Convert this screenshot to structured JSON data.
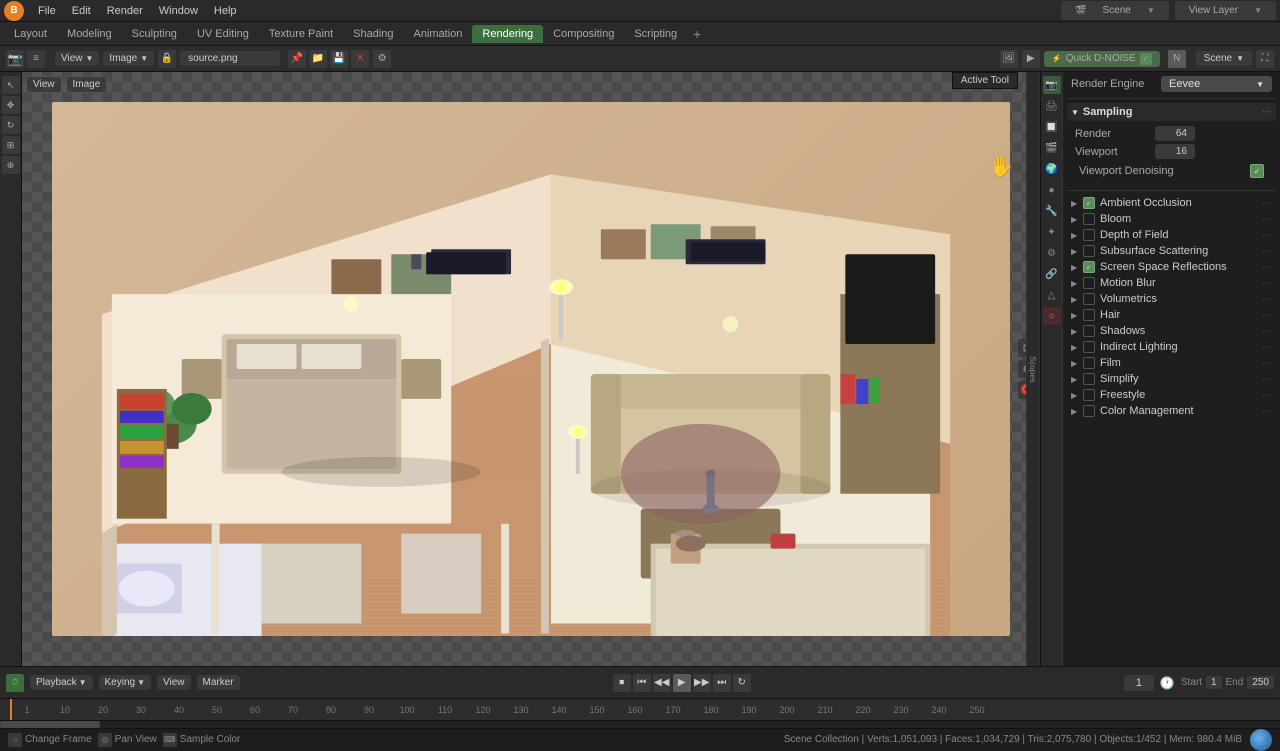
{
  "app": {
    "title": "Blender",
    "icon": "B"
  },
  "menubar": {
    "items": [
      "File",
      "Edit",
      "Render",
      "Window",
      "Help"
    ],
    "active": "Layout",
    "scene_name": "Scene",
    "layer_name": "View Layer"
  },
  "workspace_tabs": {
    "tabs": [
      "Layout",
      "Modeling",
      "Sculpting",
      "UV Editing",
      "Texture Paint",
      "Shading",
      "Animation",
      "Rendering",
      "Compositing",
      "Scripting"
    ],
    "active": "Rendering"
  },
  "image_editor": {
    "view_label": "View",
    "image_label": "Image",
    "filename": "source.png",
    "denoise_label": "Quick D-NOISE",
    "scene_label": "Scene"
  },
  "active_tool": {
    "label": "Active Tool"
  },
  "render_props": {
    "engine_label": "Render Engine",
    "engine_value": "Eevee",
    "sampling": {
      "label": "Sampling",
      "render_label": "Render",
      "render_value": "64",
      "viewport_label": "Viewport",
      "viewport_value": "16",
      "denoising_label": "Viewport Denoising",
      "denoising_checked": true
    },
    "effects": [
      {
        "id": "ambient-occlusion",
        "label": "Ambient Occlusion",
        "enabled": true,
        "checked": true,
        "expanded": false
      },
      {
        "id": "bloom",
        "label": "Bloom",
        "enabled": false,
        "checked": false,
        "expanded": false
      },
      {
        "id": "depth-of-field",
        "label": "Depth of Field",
        "enabled": false,
        "checked": false,
        "expanded": false
      },
      {
        "id": "subsurface-scattering",
        "label": "Subsurface Scattering",
        "enabled": false,
        "checked": false,
        "expanded": false
      },
      {
        "id": "screen-space-reflections",
        "label": "Screen Space Reflections",
        "enabled": true,
        "checked": true,
        "expanded": false
      },
      {
        "id": "motion-blur",
        "label": "Motion Blur",
        "enabled": false,
        "checked": false,
        "expanded": false
      },
      {
        "id": "volumetrics",
        "label": "Volumetrics",
        "enabled": false,
        "checked": false,
        "expanded": false
      },
      {
        "id": "hair",
        "label": "Hair",
        "enabled": false,
        "checked": false,
        "expanded": false
      },
      {
        "id": "shadows",
        "label": "Shadows",
        "enabled": false,
        "checked": false,
        "expanded": false
      },
      {
        "id": "indirect-lighting",
        "label": "Indirect Lighting",
        "enabled": false,
        "checked": false,
        "expanded": false
      },
      {
        "id": "film",
        "label": "Film",
        "enabled": false,
        "checked": false,
        "expanded": false
      },
      {
        "id": "simplify",
        "label": "Simplify",
        "enabled": false,
        "checked": false,
        "expanded": false
      },
      {
        "id": "freestyle",
        "label": "Freestyle",
        "enabled": false,
        "checked": false,
        "expanded": false
      },
      {
        "id": "color-management",
        "label": "Color Management",
        "enabled": false,
        "checked": false,
        "expanded": false
      }
    ]
  },
  "timeline": {
    "playback_label": "Playback",
    "keying_label": "Keying",
    "view_label": "View",
    "marker_label": "Marker",
    "current_frame": "1",
    "start_label": "Start",
    "start_value": "1",
    "end_label": "End",
    "end_value": "250"
  },
  "frame_ruler": {
    "ticks": [
      "1",
      "10",
      "20",
      "30",
      "40",
      "50",
      "60",
      "70",
      "80",
      "90",
      "100",
      "110",
      "120",
      "130",
      "140",
      "150",
      "160",
      "170",
      "180",
      "190",
      "200",
      "210",
      "220",
      "230",
      "240",
      "250"
    ]
  },
  "statusbar": {
    "change_frame_label": "Change Frame",
    "pan_view_label": "Pan View",
    "sample_color_label": "Sample Color",
    "stats": "Scene Collection | Verts:1,051,093 | Faces:1,034,729 | Tris:2,075,780 | Objects:1/452 | Mem: 980.4 MiB"
  },
  "icons": {
    "arrow_right": "▶",
    "arrow_down": "▼",
    "check": "✓",
    "dots": "···",
    "chevron_left": "◀",
    "chevron_right": "▶",
    "play": "▶",
    "pause": "⏸",
    "stop": "⏹",
    "skip_start": "⏮",
    "skip_end": "⏭",
    "prev_frame": "⏴",
    "next_frame": "⏵",
    "camera": "📷",
    "hand": "✋",
    "cross": "✕",
    "wrench": "🔧",
    "sphere": "●",
    "link": "🔗",
    "scene": "🎬"
  }
}
